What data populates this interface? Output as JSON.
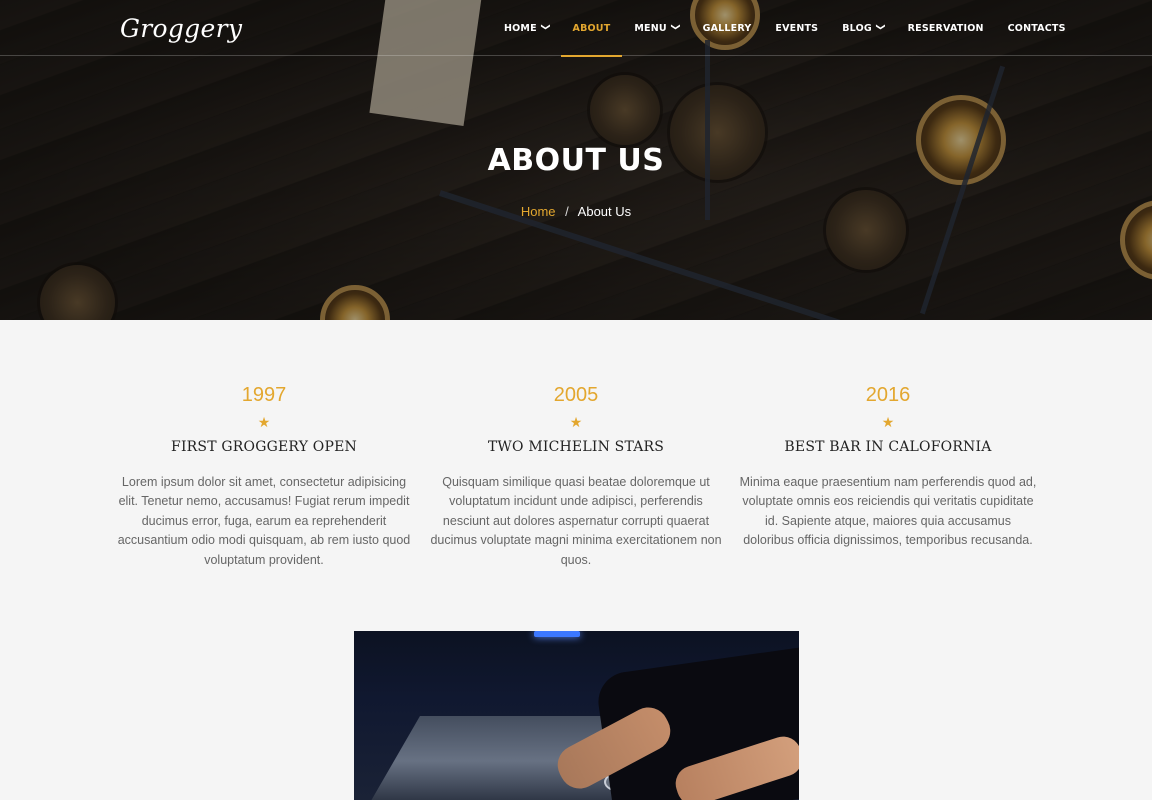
{
  "brand": {
    "logo": "Groggery"
  },
  "nav": {
    "items": [
      {
        "label": "HOME",
        "dropdown": true,
        "active": false
      },
      {
        "label": "ABOUT",
        "dropdown": false,
        "active": true
      },
      {
        "label": "MENU",
        "dropdown": true,
        "active": false
      },
      {
        "label": "GALLERY",
        "dropdown": false,
        "active": false
      },
      {
        "label": "EVENTS",
        "dropdown": false,
        "active": false
      },
      {
        "label": "BLOG",
        "dropdown": true,
        "active": false
      },
      {
        "label": "RESERVATION",
        "dropdown": false,
        "active": false
      },
      {
        "label": "CONTACTS",
        "dropdown": false,
        "active": false
      }
    ],
    "chevron_icon": "chevron-down-icon"
  },
  "hero": {
    "title": "ABOUT US",
    "breadcrumb": {
      "home": "Home",
      "separator": "/",
      "current": "About Us"
    }
  },
  "timeline": [
    {
      "year": "1997",
      "star": "★",
      "heading": "FIRST GROGGERY OPEN",
      "text": "Lorem ipsum dolor sit amet, consectetur adipisicing elit. Tenetur nemo, accusamus! Fugiat rerum impedit ducimus error, fuga, earum ea reprehenderit accusantium odio modi quisquam, ab rem iusto quod voluptatum provident."
    },
    {
      "year": "2005",
      "star": "★",
      "heading": "TWO MICHELIN STARS",
      "text": "Quisquam similique quasi beatae doloremque ut voluptatum incidunt unde adipisci, perferendis nesciunt aut dolores aspernatur corrupti quaerat ducimus voluptate magni minima exercitationem non quos."
    },
    {
      "year": "2016",
      "star": "★",
      "heading": "BEST BAR IN CALOFORNIA",
      "text": "Minima eaque praesentium nam perferendis quod ad, voluptate omnis eos reiciendis qui veritatis cupiditate id. Sapiente atque, maiores quia accusamus doloribus officia dignissimos, temporibus recusanda."
    }
  ],
  "colors": {
    "accent": "#e3a72f",
    "background": "#f5f5f5",
    "heading": "#222222",
    "body_text": "#666666"
  }
}
